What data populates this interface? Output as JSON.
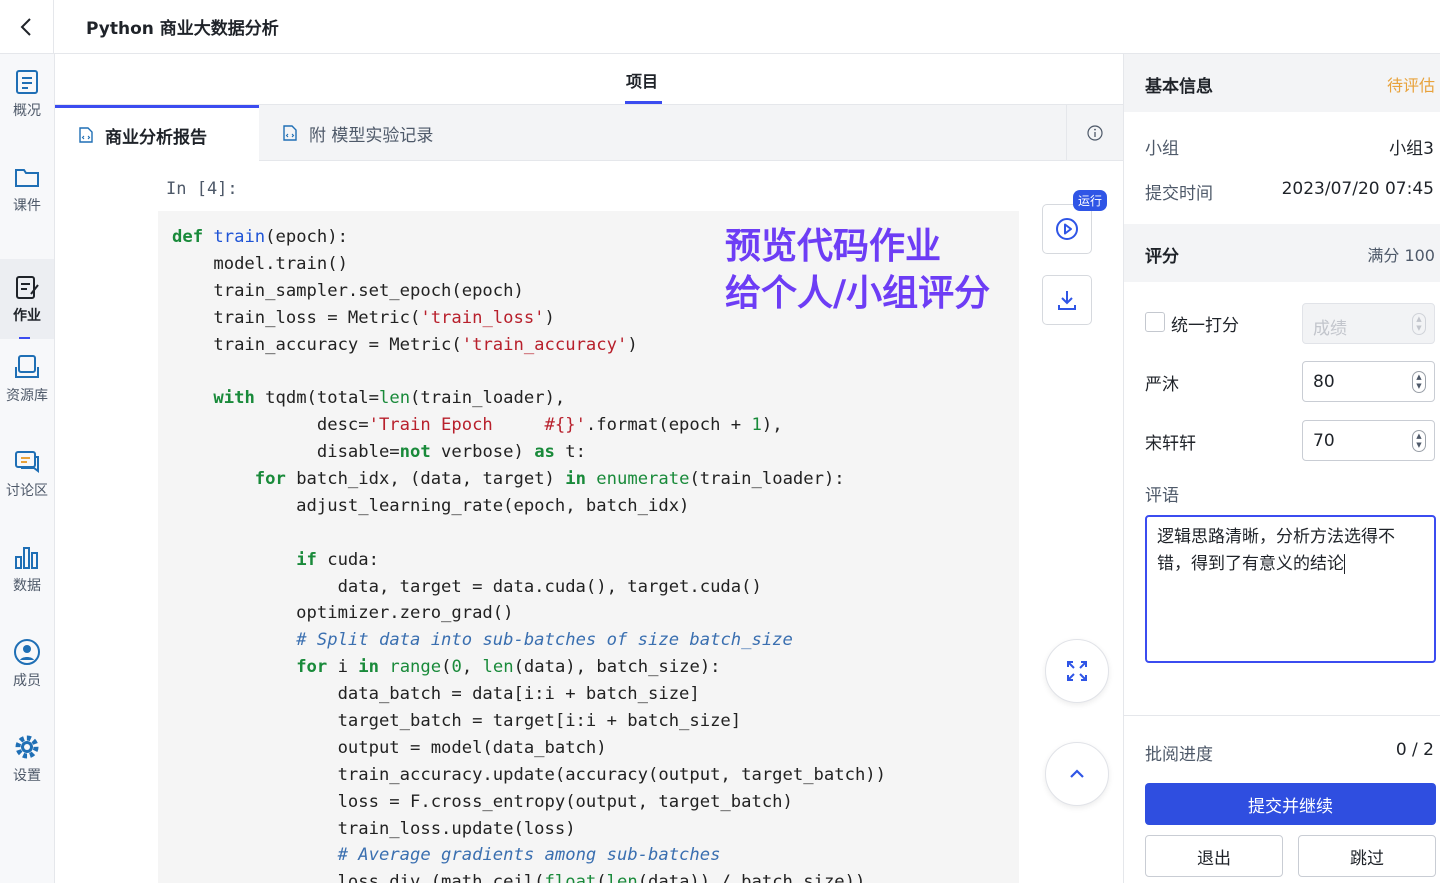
{
  "app": {
    "title": "Python 商业大数据分析"
  },
  "sidebar": {
    "items": [
      {
        "label": "概况",
        "icon": "overview-icon"
      },
      {
        "label": "课件",
        "icon": "courseware-icon"
      },
      {
        "label": "作业",
        "icon": "assignment-icon",
        "active": true
      },
      {
        "label": "资源库",
        "icon": "resource-icon"
      },
      {
        "label": "讨论区",
        "icon": "discussion-icon"
      },
      {
        "label": "数据",
        "icon": "data-icon"
      },
      {
        "label": "成员",
        "icon": "member-icon"
      },
      {
        "label": "设置",
        "icon": "settings-icon"
      }
    ]
  },
  "main": {
    "tab": "项目",
    "file_tabs": [
      {
        "label": "商业分析报告",
        "active": true
      },
      {
        "label": "附 模型实验记录",
        "active": false
      }
    ],
    "prompt": "In [4]:",
    "overlay_note": [
      "预览代码作业",
      "给个人/小组评分"
    ],
    "run_badge": "运行"
  },
  "code_lines": [
    "def train(epoch):",
    "    model.train()",
    "    train_sampler.set_epoch(epoch)",
    "    train_loss = Metric('train_loss')",
    "    train_accuracy = Metric('train_accuracy')",
    "",
    "    with tqdm(total=len(train_loader),",
    "              desc='Train Epoch     #{}'.format(epoch + 1),",
    "              disable=not verbose) as t:",
    "        for batch_idx, (data, target) in enumerate(train_loader):",
    "            adjust_learning_rate(epoch, batch_idx)",
    "",
    "            if cuda:",
    "                data, target = data.cuda(), target.cuda()",
    "            optimizer.zero_grad()",
    "            # Split data into sub-batches of size batch_size",
    "            for i in range(0, len(data), batch_size):",
    "                data_batch = data[i:i + batch_size]",
    "                target_batch = target[i:i + batch_size]",
    "                output = model(data_batch)",
    "                train_accuracy.update(accuracy(output, target_batch))",
    "                loss = F.cross_entropy(output, target_batch)",
    "                train_loss.update(loss)",
    "                # Average gradients among sub-batches",
    "                loss_div_(math.ceil(float(len(data)) / batch_size))"
  ],
  "panel": {
    "basic": {
      "title": "基本信息",
      "status": "待评估"
    },
    "group_label": "小组",
    "group_value": "小组3",
    "time_label": "提交时间",
    "time_value": "2023/07/20 07:45",
    "score": {
      "title": "评分",
      "full": "满分 100"
    },
    "unified_label": "统一打分",
    "unified_placeholder": "成绩",
    "members": [
      {
        "name": "严沐",
        "score": "80"
      },
      {
        "name": "宋轩轩",
        "score": "70"
      }
    ],
    "comment_label": "评语",
    "comment_text": "逻辑思路清晰，分析方法选得不错，得到了有意义的结论",
    "progress_label": "批阅进度",
    "progress_value": "0 / 2",
    "submit_label": "提交并继续",
    "exit_label": "退出",
    "skip_label": "跳过"
  },
  "colors": {
    "accent": "#3b4cf0",
    "primary_button": "#2f4ee0",
    "pending": "#e8a23b",
    "note": "#6d3df5"
  }
}
